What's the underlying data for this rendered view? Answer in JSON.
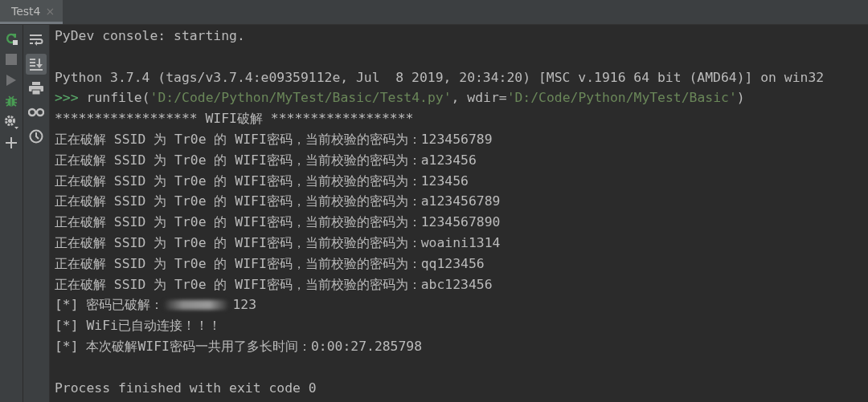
{
  "tab": {
    "title": "Test4",
    "close": "×",
    "selected": true
  },
  "left_toolbar": [
    {
      "kind": "rerun",
      "disabled": false
    },
    {
      "kind": "stop",
      "disabled": true
    },
    {
      "kind": "run",
      "disabled": true
    },
    {
      "kind": "debug",
      "disabled": false
    },
    {
      "kind": "settings",
      "disabled": false
    },
    {
      "kind": "add",
      "disabled": false
    }
  ],
  "right_toolbar": [
    {
      "kind": "soft-wrap",
      "on": false
    },
    {
      "kind": "scroll-end",
      "on": true
    },
    {
      "kind": "print",
      "on": false
    },
    {
      "kind": "variables",
      "on": false
    },
    {
      "kind": "history",
      "on": false
    }
  ],
  "console": [
    {
      "kind": "text",
      "text": "PyDev console: starting."
    },
    {
      "kind": "blank"
    },
    {
      "kind": "text",
      "text": "Python 3.7.4 (tags/v3.7.4:e09359112e, Jul  8 2019, 20:34:20) [MSC v.1916 64 bit (AMD64)] on win32"
    },
    {
      "kind": "command",
      "prompt": ">>>",
      "segments": [
        {
          "kind": "code",
          "text": "runfile("
        },
        {
          "kind": "string",
          "text": "'D:/Code/Python/MyTest/Basic/Test4.py'"
        },
        {
          "kind": "code",
          "text": ", wdir="
        },
        {
          "kind": "string",
          "text": "'D:/Code/Python/MyTest/Basic'"
        },
        {
          "kind": "code",
          "text": ")"
        }
      ]
    },
    {
      "kind": "text",
      "text": "****************** WIFI破解 ******************"
    },
    {
      "kind": "text",
      "text": "正在破解 SSID 为 Tr0e 的 WIFI密码，当前校验的密码为：123456789"
    },
    {
      "kind": "text",
      "text": "正在破解 SSID 为 Tr0e 的 WIFI密码，当前校验的密码为：a123456"
    },
    {
      "kind": "text",
      "text": "正在破解 SSID 为 Tr0e 的 WIFI密码，当前校验的密码为：123456"
    },
    {
      "kind": "text",
      "text": "正在破解 SSID 为 Tr0e 的 WIFI密码，当前校验的密码为：a123456789"
    },
    {
      "kind": "text",
      "text": "正在破解 SSID 为 Tr0e 的 WIFI密码，当前校验的密码为：1234567890"
    },
    {
      "kind": "text",
      "text": "正在破解 SSID 为 Tr0e 的 WIFI密码，当前校验的密码为：woaini1314"
    },
    {
      "kind": "text",
      "text": "正在破解 SSID 为 Tr0e 的 WIFI密码，当前校验的密码为：qq123456"
    },
    {
      "kind": "text",
      "text": "正在破解 SSID 为 Tr0e 的 WIFI密码，当前校验的密码为：abc123456"
    },
    {
      "kind": "redacted",
      "before": "[*] 密码已破解：",
      "after": "123"
    },
    {
      "kind": "text",
      "text": "[*] WiFi已自动连接！！！"
    },
    {
      "kind": "text",
      "text": "[*] 本次破解WIFI密码一共用了多长时间：0:00:27.285798"
    },
    {
      "kind": "blank"
    },
    {
      "kind": "text",
      "text": "Process finished with exit code 0"
    }
  ]
}
